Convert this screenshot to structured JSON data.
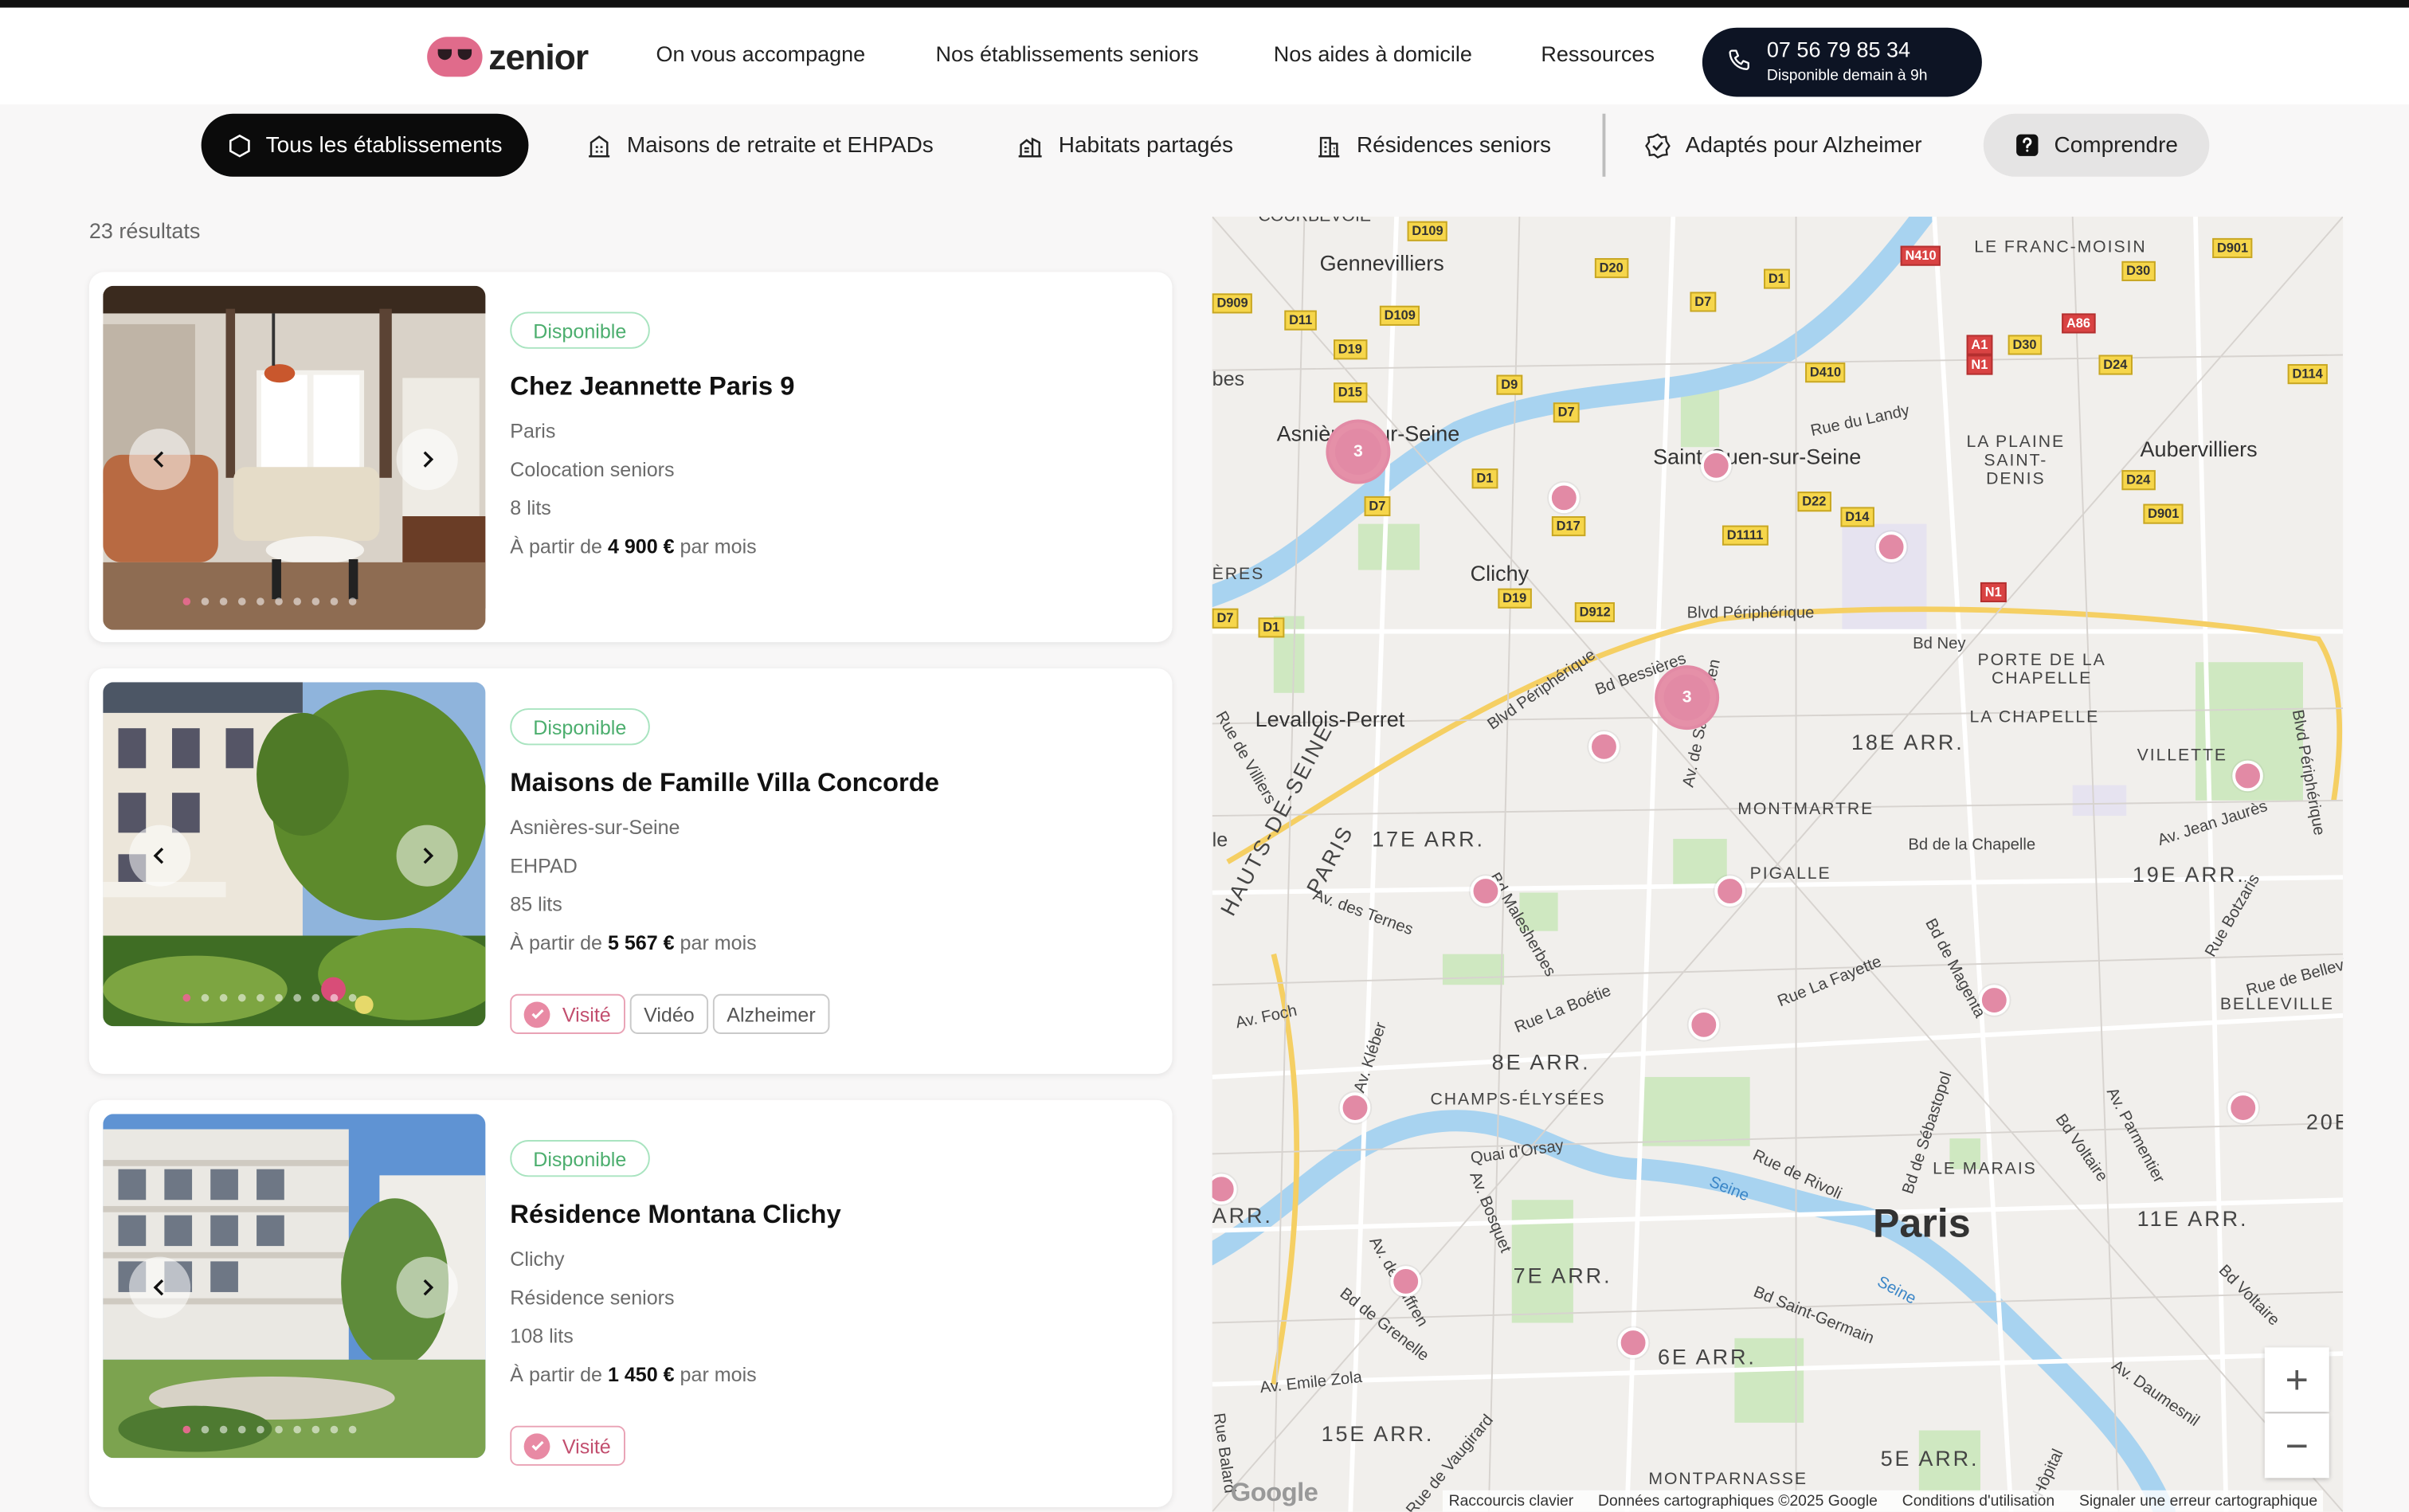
{
  "header": {
    "brand": "zenior",
    "nav": [
      "On vous accompagne",
      "Nos établissements seniors",
      "Nos aides à domicile",
      "Ressources"
    ],
    "phone": {
      "number": "07 56 79 85 34",
      "subtitle": "Disponible demain à 9h"
    }
  },
  "filters": {
    "all": "Tous les établissements",
    "ehpad": "Maisons de retraite et EHPADs",
    "shared": "Habitats partagés",
    "residences": "Résidences seniors",
    "alzheimer": "Adaptés pour Alzheimer",
    "understand": "Comprendre"
  },
  "results_count": "23 résultats",
  "listings": [
    {
      "badge": "Disponible",
      "title": "Chez Jeannette Paris 9",
      "city": "Paris",
      "type": "Colocation seniors",
      "beds": "8 lits",
      "price_prefix": "À partir de ",
      "price": "4 900 €",
      "price_suffix": " par mois",
      "tags": []
    },
    {
      "badge": "Disponible",
      "title": "Maisons de Famille Villa Concorde",
      "city": "Asnières-sur-Seine",
      "type": "EHPAD",
      "beds": "85 lits",
      "price_prefix": "À partir de ",
      "price": "5 567 €",
      "price_suffix": " par mois",
      "tags": [
        "Visité",
        "Vidéo",
        "Alzheimer"
      ]
    },
    {
      "badge": "Disponible",
      "title": "Résidence Montana Clichy",
      "city": "Clichy",
      "type": "Résidence seniors",
      "beds": "108 lits",
      "price_prefix": "À partir de ",
      "price": "1 450 €",
      "price_suffix": " par mois",
      "tags": [
        "Visité"
      ]
    }
  ],
  "map": {
    "places": [
      "Gennevilliers",
      "Asnières-sur-Seine",
      "Saint-Ouen-sur-Seine",
      "Clichy",
      "Levallois-Perret",
      "Aubervilliers",
      "LE FRANC-MOISIN",
      "LA PLAINE SAINT-DENIS",
      "PORTE DE LA CHAPELLE",
      "LA CHAPELLE",
      "18E ARR.",
      "VILLETTE",
      "MONTMARTRE",
      "PIGALLE",
      "19E ARR.",
      "BELLEVILLE",
      "17E ARR.",
      "8E ARR.",
      "CHAMPS-ÉLYSÉES",
      "LE MARAIS",
      "11E ARR.",
      "7E ARR.",
      "6E ARR.",
      "15E ARR.",
      "5E ARR.",
      "MONTPARNASSE",
      "HAUTS-DE-SEINE",
      "PARIS",
      "ÈRES",
      "ARR.",
      "20E",
      "bes",
      "le"
    ],
    "streets": [
      "Bd Ney",
      "Bd Bessières",
      "Blvd Périphérique",
      "Blvd Périphérique",
      "Rue du Landy",
      "Bd Malesherbes",
      "Av. des Ternes",
      "Rue de Villiers",
      "Av. de Saint-Ouen",
      "Bd de la Chapelle",
      "Av. Jean Jaurès",
      "Rue Botzaris",
      "Rue de Belleville",
      "Bd de Magenta",
      "Rue La Fayette",
      "Rue La Boétie",
      "Av. Foch",
      "Av. Kléber",
      "Quai d'Orsay",
      "Av. Bosquet",
      "Av. de Suffren",
      "Bd de Grenelle",
      "Av. Emile Zola",
      "Rue de Rivoli",
      "Bd de Sébastopol",
      "Bd Voltaire",
      "Av. Parmentier",
      "Bd Saint-Germain",
      "Bd Voltaire",
      "Av. Daumesnil",
      "Seine",
      "Seine",
      "Blvd Périphérique",
      "Rue Balard",
      "Rue de Vaugirard",
      "Hôpital"
    ],
    "road_numbers": [
      "D109",
      "D20",
      "D7",
      "D1",
      "N410",
      "D901",
      "D30",
      "D909",
      "D11",
      "D109",
      "D19",
      "D15",
      "D9",
      "D7",
      "D410",
      "A1",
      "N1",
      "D30",
      "A86",
      "D24",
      "D114",
      "D1",
      "D7",
      "D17",
      "D22",
      "D14",
      "D1111",
      "D24",
      "D901",
      "D19",
      "D1",
      "D912",
      "N1",
      "D7"
    ],
    "clusters": [
      "3",
      "3"
    ],
    "city_label": "Paris",
    "cut_top": "COURBEVOIE",
    "google": "Google",
    "attribution": [
      "Raccourcis clavier",
      "Données cartographiques ©2025 Google",
      "Conditions d'utilisation",
      "Signaler une erreur cartographique"
    ],
    "zoom_in": "+",
    "zoom_out": "−"
  },
  "colors": {
    "accent_pink": "#e28aa5",
    "available_green": "#4cae6e",
    "dark": "#0b0b0b"
  }
}
